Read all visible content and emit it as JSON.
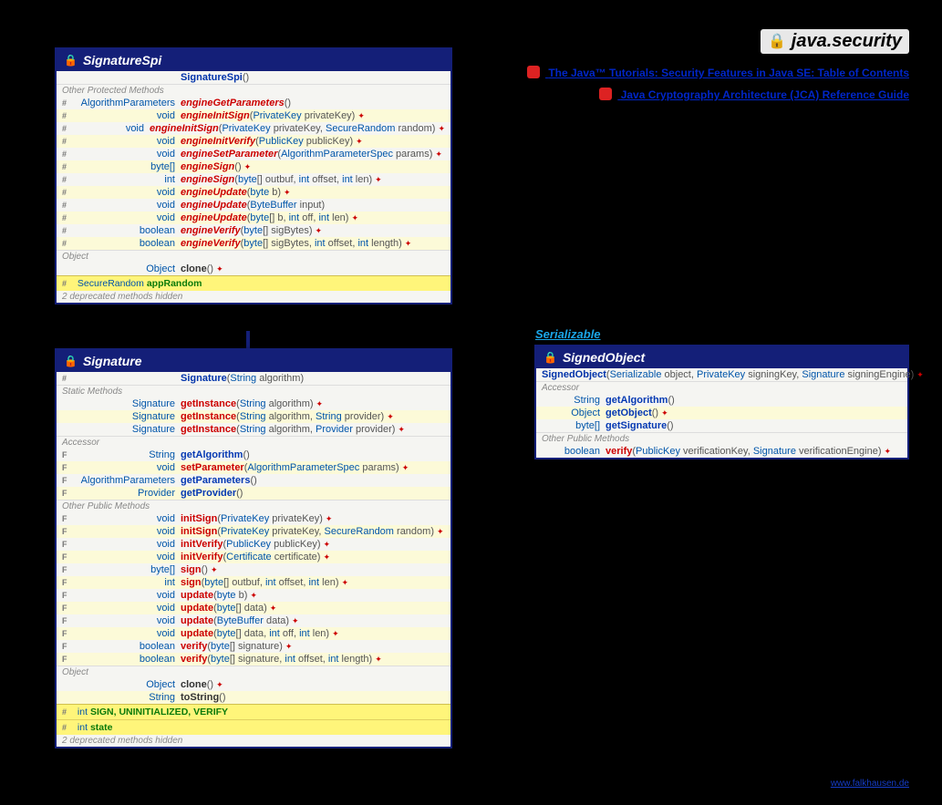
{
  "package": {
    "name": "java.security"
  },
  "links": {
    "tutorials": "The Java™ Tutorials: Security Features in Java SE: Table of Contents",
    "jca": "Java Cryptography Architecture (JCA) Reference Guide"
  },
  "footer": "www.falkhausen.de",
  "interfaceLabel": "Serializable",
  "sigSpi": {
    "title": "SignatureSpi",
    "ctor": {
      "name": "SignatureSpi",
      "params": "()"
    },
    "secOtherProt": "Other Protected Methods",
    "rows": [
      {
        "mod": "#",
        "ret": "AlgorithmParameters",
        "name": "engineGetParameters",
        "params": "()",
        "exc": "",
        "s": false
      },
      {
        "mod": "#",
        "ret": "void",
        "name": "engineInitSign",
        "params": "(PrivateKey privateKey)",
        "exc": "✦",
        "s": true
      },
      {
        "mod": "#",
        "ret": "void",
        "name": "engineInitSign",
        "params": "(PrivateKey privateKey, SecureRandom random)",
        "exc": "✦",
        "s": false
      },
      {
        "mod": "#",
        "ret": "void",
        "name": "engineInitVerify",
        "params": "(PublicKey publicKey)",
        "exc": "✦",
        "s": true
      },
      {
        "mod": "#",
        "ret": "void",
        "name": "engineSetParameter",
        "params": "(AlgorithmParameterSpec params)",
        "exc": "✦",
        "s": false
      },
      {
        "mod": "#",
        "ret": "byte[]",
        "name": "engineSign",
        "params": "()",
        "exc": "✦",
        "s": true
      },
      {
        "mod": "#",
        "ret": "int",
        "name": "engineSign",
        "params": "(byte[] outbuf, int offset, int len)",
        "exc": "✦",
        "s": false
      },
      {
        "mod": "#",
        "ret": "void",
        "name": "engineUpdate",
        "params": "(byte b)",
        "exc": "✦",
        "s": true
      },
      {
        "mod": "#",
        "ret": "void",
        "name": "engineUpdate",
        "params": "(ByteBuffer input)",
        "exc": "",
        "s": false
      },
      {
        "mod": "#",
        "ret": "void",
        "name": "engineUpdate",
        "params": "(byte[] b, int off, int len)",
        "exc": "✦",
        "s": true
      },
      {
        "mod": "#",
        "ret": "boolean",
        "name": "engineVerify",
        "params": "(byte[] sigBytes)",
        "exc": "✦",
        "s": false
      },
      {
        "mod": "#",
        "ret": "boolean",
        "name": "engineVerify",
        "params": "(byte[] sigBytes, int offset, int length)",
        "exc": "✦",
        "s": true
      }
    ],
    "secObject": "Object",
    "objRows": [
      {
        "mod": "",
        "ret": "Object",
        "name": "clone",
        "params": "()",
        "exc": "✦",
        "s": false
      }
    ],
    "fieldBand": [
      {
        "mod": "#",
        "type": "SecureRandom",
        "name": "appRandom"
      }
    ],
    "hidden": "2 deprecated methods hidden"
  },
  "sig": {
    "title": "Signature",
    "ctor": {
      "mod": "#",
      "name": "Signature",
      "params": "(String algorithm)"
    },
    "secStatic": "Static Methods",
    "staticRows": [
      {
        "mod": "",
        "ret": "Signature",
        "name": "getInstance",
        "params": "(String algorithm)",
        "exc": "✦",
        "s": false
      },
      {
        "mod": "",
        "ret": "Signature",
        "name": "getInstance",
        "params": "(String algorithm, String provider)",
        "exc": "✦",
        "s": true
      },
      {
        "mod": "",
        "ret": "Signature",
        "name": "getInstance",
        "params": "(String algorithm, Provider provider)",
        "exc": "✦",
        "s": false
      }
    ],
    "secAccessor": "Accessor",
    "accRows": [
      {
        "mod": "F",
        "ret": "String",
        "name": "getAlgorithm",
        "params": "()",
        "exc": "",
        "s": false,
        "color": "blue"
      },
      {
        "mod": "F",
        "ret": "void",
        "name": "setParameter",
        "params": "(AlgorithmParameterSpec params)",
        "exc": "✦",
        "s": true,
        "color": "red"
      },
      {
        "mod": "F",
        "ret": "AlgorithmParameters",
        "name": "getParameters",
        "params": "()",
        "exc": "",
        "s": false,
        "color": "blue"
      },
      {
        "mod": "F",
        "ret": "Provider",
        "name": "getProvider",
        "params": "()",
        "exc": "",
        "s": true,
        "color": "blue"
      }
    ],
    "secOtherPub": "Other Public Methods",
    "pubRows": [
      {
        "mod": "F",
        "ret": "void",
        "name": "initSign",
        "params": "(PrivateKey privateKey)",
        "exc": "✦",
        "s": false
      },
      {
        "mod": "F",
        "ret": "void",
        "name": "initSign",
        "params": "(PrivateKey privateKey, SecureRandom random)",
        "exc": "✦",
        "s": true
      },
      {
        "mod": "F",
        "ret": "void",
        "name": "initVerify",
        "params": "(PublicKey publicKey)",
        "exc": "✦",
        "s": false
      },
      {
        "mod": "F",
        "ret": "void",
        "name": "initVerify",
        "params": "(Certificate certificate)",
        "exc": "✦",
        "s": true
      },
      {
        "mod": "F",
        "ret": "byte[]",
        "name": "sign",
        "params": "()",
        "exc": "✦",
        "s": false
      },
      {
        "mod": "F",
        "ret": "int",
        "name": "sign",
        "params": "(byte[] outbuf, int offset, int len)",
        "exc": "✦",
        "s": true
      },
      {
        "mod": "F",
        "ret": "void",
        "name": "update",
        "params": "(byte b)",
        "exc": "✦",
        "s": false
      },
      {
        "mod": "F",
        "ret": "void",
        "name": "update",
        "params": "(byte[] data)",
        "exc": "✦",
        "s": true
      },
      {
        "mod": "F",
        "ret": "void",
        "name": "update",
        "params": "(ByteBuffer data)",
        "exc": "✦",
        "s": false
      },
      {
        "mod": "F",
        "ret": "void",
        "name": "update",
        "params": "(byte[] data, int off, int len)",
        "exc": "✦",
        "s": true
      },
      {
        "mod": "F",
        "ret": "boolean",
        "name": "verify",
        "params": "(byte[] signature)",
        "exc": "✦",
        "s": false
      },
      {
        "mod": "F",
        "ret": "boolean",
        "name": "verify",
        "params": "(byte[] signature, int offset, int length)",
        "exc": "✦",
        "s": true
      }
    ],
    "secObject": "Object",
    "objRows": [
      {
        "mod": "",
        "ret": "Object",
        "name": "clone",
        "params": "()",
        "exc": "✦",
        "s": false
      },
      {
        "mod": "",
        "ret": "String",
        "name": "toString",
        "params": "()",
        "exc": "",
        "s": true
      }
    ],
    "constBand": [
      {
        "mod": "#",
        "type": "int",
        "name": "SIGN, UNINITIALIZED, VERIFY"
      },
      {
        "mod": "#",
        "type": "int",
        "name": "state"
      }
    ],
    "hidden": "2 deprecated methods hidden"
  },
  "signedObj": {
    "title": "SignedObject",
    "ctor": {
      "name": "SignedObject",
      "params": "(Serializable object, PrivateKey signingKey, Signature signingEngine)",
      "exc": "✦"
    },
    "secAccessor": "Accessor",
    "accRows": [
      {
        "mod": "",
        "ret": "String",
        "name": "getAlgorithm",
        "params": "()",
        "exc": "",
        "s": false,
        "color": "blue"
      },
      {
        "mod": "",
        "ret": "Object",
        "name": "getObject",
        "params": "()",
        "exc": "✦",
        "s": true,
        "color": "blue"
      },
      {
        "mod": "",
        "ret": "byte[]",
        "name": "getSignature",
        "params": "()",
        "exc": "",
        "s": false,
        "color": "blue"
      }
    ],
    "secOtherPub": "Other Public Methods",
    "pubRows": [
      {
        "mod": "",
        "ret": "boolean",
        "name": "verify",
        "params": "(PublicKey verificationKey, Signature verificationEngine)",
        "exc": "✦",
        "s": false
      }
    ]
  }
}
